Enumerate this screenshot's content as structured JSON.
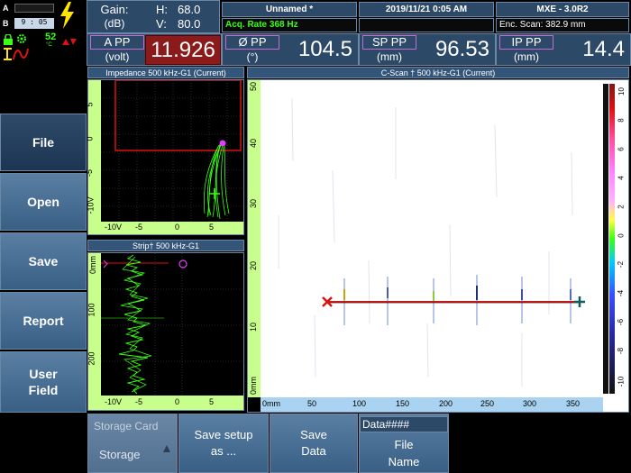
{
  "status": {
    "battery_a": "A",
    "battery_b": "B",
    "time": "9 : 05",
    "temp": "52",
    "temp_unit": "°C"
  },
  "header": {
    "gain_label": "Gain:",
    "gain_unit": "(dB)",
    "h_label": "H:",
    "h_value": "68.0",
    "v_label": "V:",
    "v_value": "80.0",
    "file_name": "Unnamed *",
    "date_time": "2019/11/21 0:05 AM",
    "version": "MXE - 3.0R2",
    "acq_rate": "Acq. Rate 368  Hz",
    "enc_scan": "Enc. Scan:  382.9 mm"
  },
  "readings": [
    {
      "label": "A PP",
      "unit": "(volt)",
      "value": "11.926"
    },
    {
      "label": "Ø PP",
      "unit": "(°)",
      "value": "104.5"
    },
    {
      "label": "SP PP",
      "unit": "(mm)",
      "value": "96.53"
    },
    {
      "label": "IP PP",
      "unit": "(mm)",
      "value": "14.4"
    }
  ],
  "sidebar": {
    "items": [
      {
        "label": "File",
        "active": true
      },
      {
        "label": "Open",
        "active": false
      },
      {
        "label": "Save",
        "active": false
      },
      {
        "label": "Report",
        "active": false
      },
      {
        "label": "User Field",
        "active": false
      }
    ]
  },
  "panels": {
    "impedance_title": "Impedance 500 kHz-G1 (Current)",
    "strip_title": "Strip† 500 kHz-G1",
    "cscan_title": "C-Scan † 500 kHz-G1 (Current)"
  },
  "impedance_axes": {
    "y_ticks": [
      "5",
      "0",
      "-5",
      "-10V"
    ],
    "x_ticks": [
      "-10V",
      "-5",
      "0",
      "5"
    ]
  },
  "strip_axes": {
    "y_ticks": [
      "0mm",
      "100",
      "200"
    ],
    "x_ticks": [
      "-10V",
      "-5",
      "0",
      "5"
    ]
  },
  "cscan_axes": {
    "y_ticks": [
      "50",
      "40",
      "30",
      "20",
      "10",
      "0mm"
    ],
    "x_ticks": [
      "0mm",
      "50",
      "100",
      "150",
      "200",
      "250",
      "300",
      "350"
    ],
    "colorbar_ticks": [
      "10",
      "8",
      "6",
      "4",
      "2",
      "0",
      "-2",
      "-4",
      "-6",
      "-8",
      "-10"
    ]
  },
  "bottom_menu": {
    "storage_card": "Storage Card",
    "storage": "Storage",
    "save_setup_as": "Save setup as ...",
    "save_data": "Save Data",
    "data_field": "Data####",
    "file_name": "File Name"
  },
  "colors": {
    "panel_blue": "#2c4a68",
    "accent_purple": "#c36bd9",
    "signal_green": "#39ff14",
    "red_value": "#8b1a1a"
  }
}
